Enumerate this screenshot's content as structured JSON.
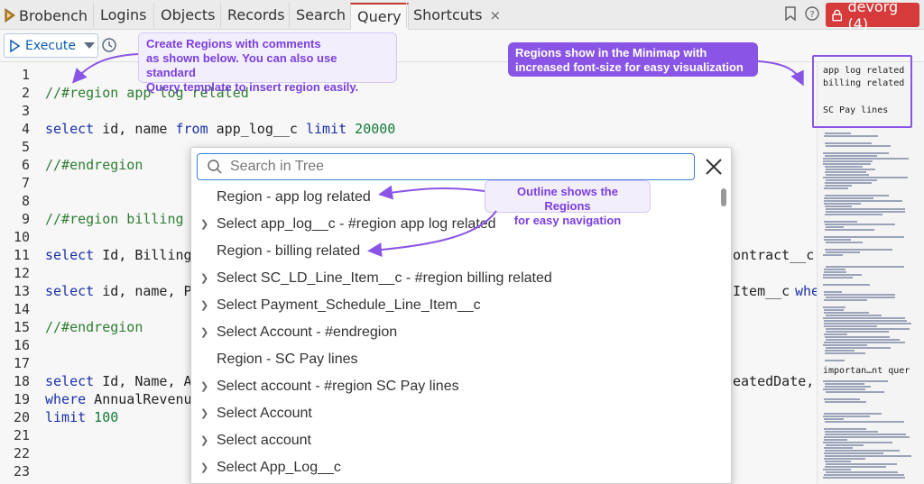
{
  "app": {
    "name": "Brobench",
    "tabs": [
      {
        "label": "Logins"
      },
      {
        "label": "Objects"
      },
      {
        "label": "Records"
      },
      {
        "label": "Search"
      },
      {
        "label": "Query"
      },
      {
        "label": "Shortcuts",
        "close": "×"
      }
    ],
    "org_label": "devorg (4)"
  },
  "toolbar": {
    "execute_label": "Execute"
  },
  "editor": {
    "lines": [
      {
        "n": "1",
        "parts": []
      },
      {
        "n": "2",
        "parts": [
          {
            "t": "cm",
            "v": "//#region app log related"
          }
        ]
      },
      {
        "n": "3",
        "parts": []
      },
      {
        "n": "4",
        "parts": [
          {
            "t": "kw",
            "v": "select"
          },
          {
            "t": "plain",
            "v": " id, name "
          },
          {
            "t": "kw",
            "v": "from"
          },
          {
            "t": "plain",
            "v": " app_log__c "
          },
          {
            "t": "kw",
            "v": "limit"
          },
          {
            "t": "num",
            "v": " 20000"
          }
        ]
      },
      {
        "n": "5",
        "parts": []
      },
      {
        "n": "6",
        "parts": [
          {
            "t": "cm",
            "v": "//#endregion"
          }
        ]
      },
      {
        "n": "7",
        "parts": []
      },
      {
        "n": "8",
        "parts": []
      },
      {
        "n": "9",
        "parts": [
          {
            "t": "cm",
            "v": "//#region billing"
          }
        ]
      },
      {
        "n": "10",
        "parts": []
      },
      {
        "n": "11",
        "parts": [
          {
            "t": "kw",
            "v": "select"
          },
          {
            "t": "plain",
            "v": " Id, Billing"
          }
        ]
      },
      {
        "n": "12",
        "parts": []
      },
      {
        "n": "13",
        "parts": [
          {
            "t": "kw",
            "v": "select"
          },
          {
            "t": "plain",
            "v": " id, name, P"
          }
        ]
      },
      {
        "n": "14",
        "parts": []
      },
      {
        "n": "15",
        "parts": [
          {
            "t": "cm",
            "v": "//#endregion"
          }
        ]
      },
      {
        "n": "16",
        "parts": []
      },
      {
        "n": "17",
        "parts": []
      },
      {
        "n": "18",
        "parts": [
          {
            "t": "kw",
            "v": "select"
          },
          {
            "t": "plain",
            "v": " Id, Name, A"
          }
        ]
      },
      {
        "n": "19",
        "parts": [
          {
            "t": "kw",
            "v": "where"
          },
          {
            "t": "plain",
            "v": " AnnualRevenu"
          }
        ]
      },
      {
        "n": "20",
        "parts": [
          {
            "t": "kw",
            "v": "limit"
          },
          {
            "t": "num",
            "v": " 100"
          }
        ]
      },
      {
        "n": "21",
        "parts": []
      },
      {
        "n": "22",
        "parts": []
      },
      {
        "n": "23",
        "parts": []
      }
    ],
    "overflow_right": {
      "line11": "ontract__c,",
      "line13_a": "Item__c ",
      "line13_b": "whe",
      "line18": "eatedDate,"
    }
  },
  "minimap": {
    "regions": [
      "app log related",
      "billing related",
      "SC Pay lines",
      "importan…nt quer"
    ]
  },
  "outline": {
    "search_placeholder": "Search in Tree",
    "items": [
      {
        "label": "Region - app log related",
        "chevron": false
      },
      {
        "label": "Select app_log__c - #region app log related",
        "chevron": true
      },
      {
        "label": "Region - billing related",
        "chevron": false
      },
      {
        "label": "Select SC_LD_Line_Item__c - #region billing related",
        "chevron": true
      },
      {
        "label": "Select Payment_Schedule_Line_Item__c",
        "chevron": true
      },
      {
        "label": "Select Account - #endregion",
        "chevron": true
      },
      {
        "label": "Region - SC Pay lines",
        "chevron": false
      },
      {
        "label": "Select account - #region SC Pay lines",
        "chevron": true
      },
      {
        "label": "Select Account",
        "chevron": true
      },
      {
        "label": "Select account",
        "chevron": true
      },
      {
        "label": "Select App_Log__c",
        "chevron": true
      }
    ]
  },
  "callouts": {
    "regions_line1": "Create Regions with comments",
    "regions_line2": "as shown below. You can also use standard",
    "regions_line3": "Query template to insert region easily.",
    "minimap_line1": "Regions show in the Minimap with",
    "minimap_line2": "increased font-size for easy visualization",
    "outline_line1": "Outline shows the Regions",
    "outline_line2": "for easy navigation"
  },
  "colors": {
    "accent_purple": "#8a55e6",
    "org_red": "#d63a3a",
    "comment_green": "#2e7d32",
    "keyword_blue": "#1a2fa8"
  }
}
